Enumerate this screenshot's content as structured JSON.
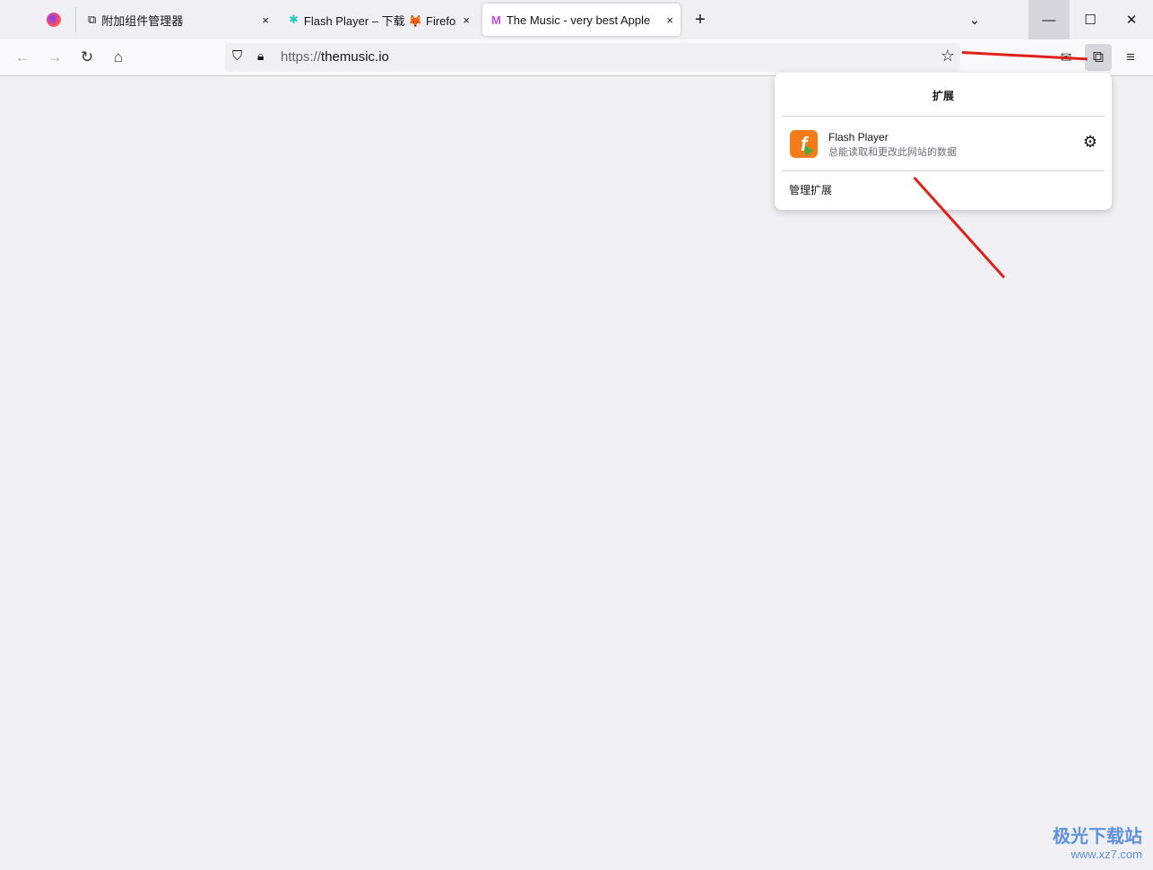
{
  "tabs": [
    {
      "label": "附加组件管理器",
      "icon": "puzzle-icon"
    },
    {
      "label": "Flash Player – 下载 🦊 Firefox",
      "icon": "flash-puzzle-icon"
    },
    {
      "label": "The Music - very best Apple Music",
      "icon": "themusic-icon",
      "active": true
    }
  ],
  "close_glyph": "×",
  "new_tab": "+",
  "url": {
    "scheme": "https://",
    "host": "themusic.io"
  },
  "extensions_panel": {
    "title": "扩展",
    "items": [
      {
        "name": "Flash Player",
        "description": "总能读取和更改此网站的数据"
      }
    ],
    "manage": "管理扩展"
  },
  "watermark": {
    "name": "极光下载站",
    "url": "www.xz7.com"
  },
  "colors": {
    "arrow": "#e0201a",
    "flash_icon": "#f47a1a"
  }
}
